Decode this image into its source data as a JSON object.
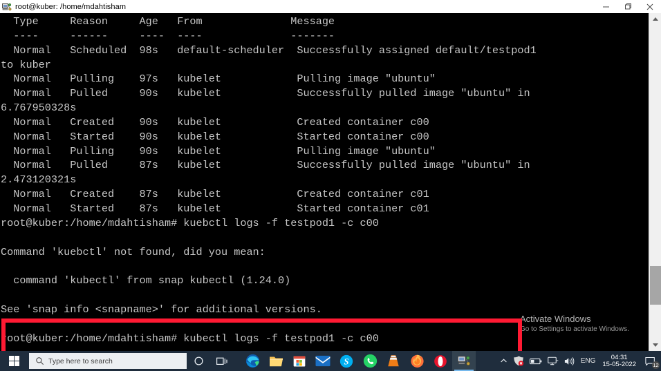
{
  "window": {
    "title": "root@kuber: /home/mdahtisham",
    "icon": "putty-icon",
    "controls": {
      "minimize": "minimize-button",
      "maximize": "maximize-button",
      "close": "close-button"
    }
  },
  "terminal": {
    "foreground_color": "#c7c7c7",
    "background_color": "#000000",
    "lines": [
      "  Type     Reason     Age   From              Message",
      "  ----     ------     ----  ----              -------",
      "  Normal   Scheduled  98s   default-scheduler  Successfully assigned default/testpod1",
      "to kuber",
      "  Normal   Pulling    97s   kubelet            Pulling image \"ubuntu\"",
      "  Normal   Pulled     90s   kubelet            Successfully pulled image \"ubuntu\" in",
      "6.767950328s",
      "  Normal   Created    90s   kubelet            Created container c00",
      "  Normal   Started    90s   kubelet            Started container c00",
      "  Normal   Pulling    90s   kubelet            Pulling image \"ubuntu\"",
      "  Normal   Pulled     87s   kubelet            Successfully pulled image \"ubuntu\" in",
      "2.473120321s",
      "  Normal   Created    87s   kubelet            Created container c01",
      "  Normal   Started    87s   kubelet            Started container c01",
      "root@kuber:/home/mdahtisham# kuebctl logs -f testpod1 -c c00",
      "",
      "Command 'kuebctl' not found, did you mean:",
      "",
      "  command 'kubectl' from snap kubectl (1.24.0)",
      "",
      "See 'snap info <snapname>' for additional versions.",
      "",
      "root@kuber:/home/mdahtisham# kubectl logs -f testpod1 -c c00"
    ]
  },
  "annotation": {
    "color": "#ff1a33",
    "highlighted_command": "root@kuber:/home/mdahtisham# kubectl logs -f testpod1 -c c00"
  },
  "watermark": {
    "title": "Activate Windows",
    "subtitle": "Go to Settings to activate Windows."
  },
  "taskbar": {
    "start": "start-button",
    "search": {
      "placeholder": "Type here to search",
      "icon": "search-icon"
    },
    "cortana": "cortana-icon",
    "task_view": "task-view-icon",
    "apps": [
      {
        "name": "microsoft-edge",
        "label": "Microsoft Edge"
      },
      {
        "name": "file-explorer",
        "label": "File Explorer"
      },
      {
        "name": "microsoft-store",
        "label": "Microsoft Store"
      },
      {
        "name": "mail",
        "label": "Mail"
      },
      {
        "name": "skype",
        "label": "Skype"
      },
      {
        "name": "whatsapp",
        "label": "WhatsApp"
      },
      {
        "name": "vlc-media-player",
        "label": "VLC media player"
      },
      {
        "name": "mozilla-firefox",
        "label": "Mozilla Firefox"
      },
      {
        "name": "opera",
        "label": "Opera"
      },
      {
        "name": "putty",
        "label": "PuTTY"
      }
    ],
    "tray": {
      "chevron": "show-hidden-icons",
      "antivirus": "antivirus-icon",
      "battery": "battery-icon",
      "network": "network-icon",
      "volume": "volume-icon",
      "language": "ENG",
      "time": "04:31",
      "date": "15-05-2022",
      "notifications_count": "12"
    }
  }
}
